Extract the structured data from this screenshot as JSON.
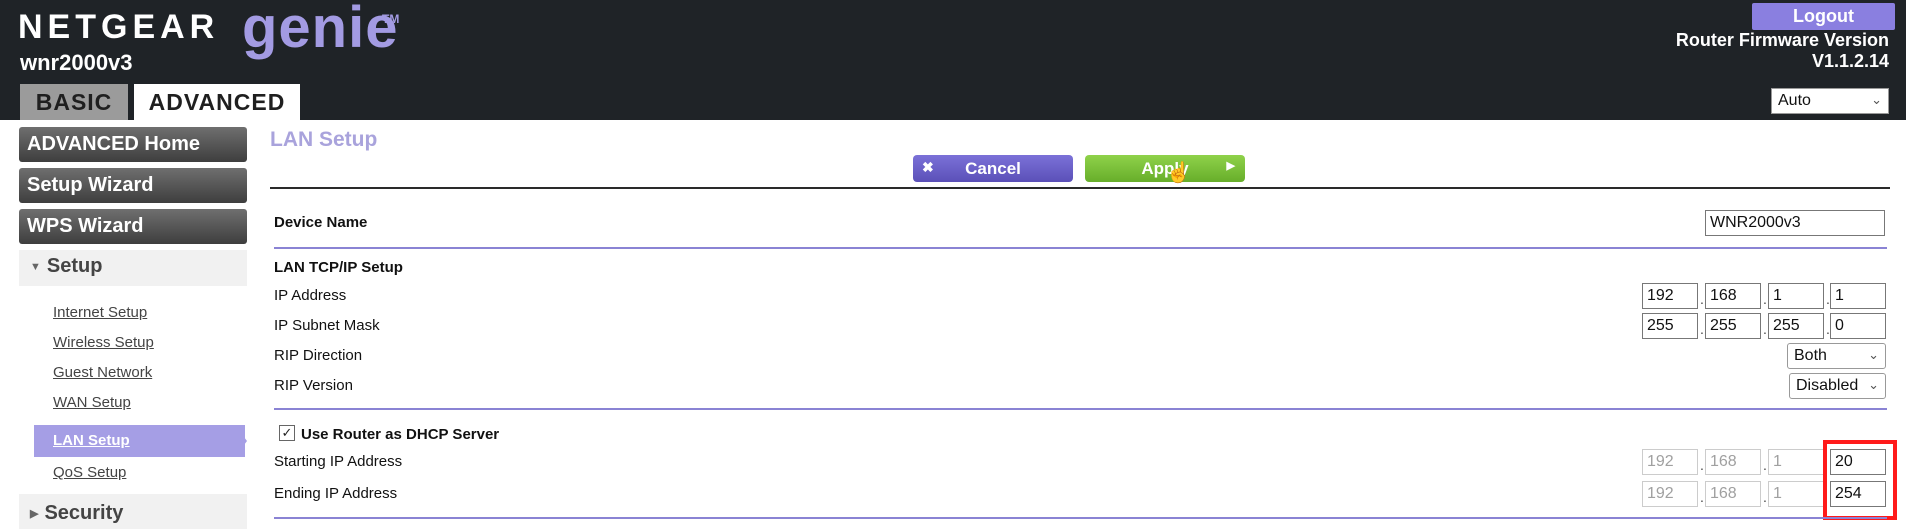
{
  "header": {
    "brand": "NETGEAR",
    "product": "genie",
    "trademark": "TM",
    "model": "wnr2000v3",
    "tabs": [
      "BASIC",
      "ADVANCED"
    ],
    "logout_label": "Logout",
    "firmware_label": "Router Firmware Version",
    "firmware_version": "V1.1.2.14",
    "language_value": "Auto"
  },
  "sidebar": {
    "buttons": [
      "ADVANCED Home",
      "Setup Wizard",
      "WPS Wizard"
    ],
    "setup_section": "Setup",
    "setup_links": [
      "Internet Setup",
      "Wireless Setup",
      "Guest Network",
      "WAN Setup",
      "LAN Setup",
      "QoS Setup"
    ],
    "active_link": "LAN Setup",
    "security_section": "Security"
  },
  "main": {
    "title": "LAN Setup",
    "cancel_label": "Cancel",
    "apply_label": "Apply",
    "device_name_label": "Device Name",
    "device_name_value": "WNR2000v3",
    "tcpip_heading": "LAN TCP/IP Setup",
    "ip_address_label": "IP Address",
    "ip_address": [
      "192",
      "168",
      "1",
      "1"
    ],
    "subnet_label": "IP Subnet Mask",
    "subnet": [
      "255",
      "255",
      "255",
      "0"
    ],
    "rip_direction_label": "RIP Direction",
    "rip_direction_value": "Both",
    "rip_version_label": "RIP Version",
    "rip_version_value": "Disabled",
    "dhcp_label": "Use Router as DHCP Server",
    "dhcp_checked": true,
    "starting_ip_label": "Starting IP Address",
    "starting_ip": [
      "192",
      "168",
      "1",
      "20"
    ],
    "ending_ip_label": "Ending IP Address",
    "ending_ip": [
      "192",
      "168",
      "1",
      "254"
    ]
  },
  "colors": {
    "header_bg": "#1f2327",
    "accent_purple": "#8a7fe0",
    "apply_green": "#7ac03a",
    "highlight_red": "#ff1a1a"
  }
}
